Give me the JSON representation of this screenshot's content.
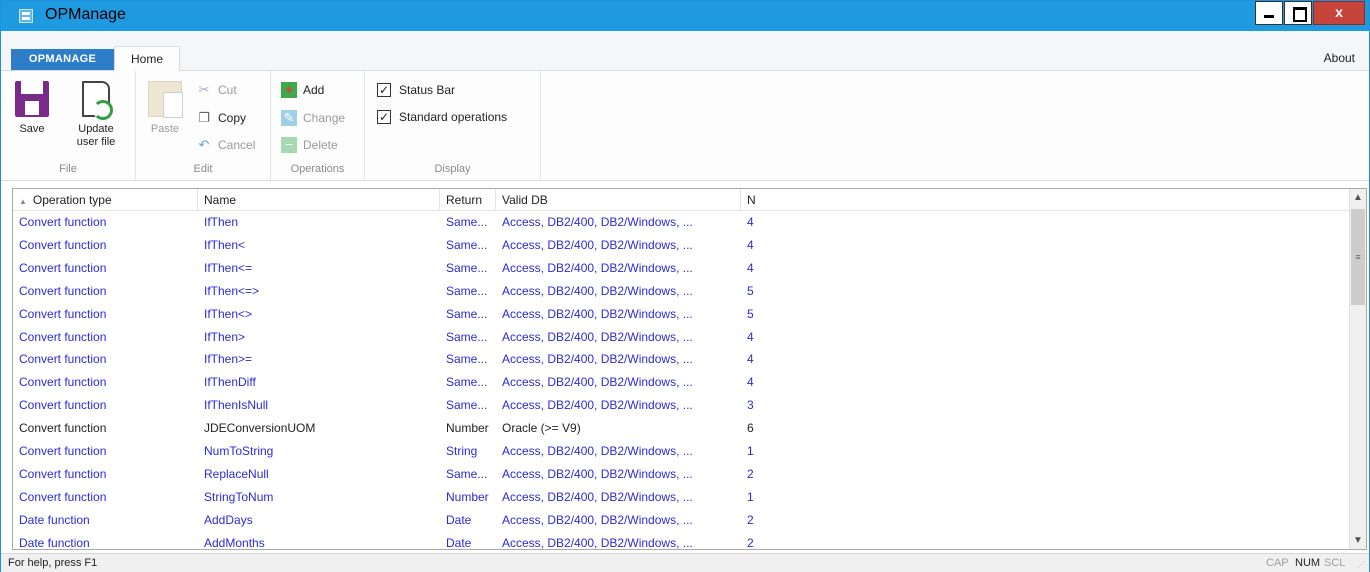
{
  "window": {
    "title": "OPManage"
  },
  "window_controls": {
    "close_label": "x"
  },
  "ribbon": {
    "app_tab": "OPMANAGE",
    "home_tab": "Home",
    "about": "About",
    "file": {
      "label": "File",
      "save": "Save",
      "update_line1": "Update",
      "update_line2": "user file"
    },
    "edit": {
      "label": "Edit",
      "paste": "Paste",
      "cut": "Cut",
      "copy": "Copy",
      "cancel": "Cancel"
    },
    "operations": {
      "label": "Operations",
      "add": "Add",
      "change": "Change",
      "delete": "Delete"
    },
    "display": {
      "label": "Display",
      "status_bar": "Status Bar",
      "status_bar_checked": true,
      "standard_operations": "Standard operations",
      "standard_operations_checked": true
    }
  },
  "table": {
    "columns": [
      "Operation type",
      "Name",
      "Return",
      "Valid DB",
      "N"
    ],
    "rows": [
      {
        "type": "Convert function",
        "name": "IfThen",
        "ret": "Same...",
        "db": "Access, DB2/400, DB2/Windows, ...",
        "n": "4",
        "color": "blue"
      },
      {
        "type": "Convert function",
        "name": "IfThen<",
        "ret": "Same...",
        "db": "Access, DB2/400, DB2/Windows, ...",
        "n": "4",
        "color": "blue"
      },
      {
        "type": "Convert function",
        "name": "IfThen<=",
        "ret": "Same...",
        "db": "Access, DB2/400, DB2/Windows, ...",
        "n": "4",
        "color": "blue"
      },
      {
        "type": "Convert function",
        "name": "IfThen<=>",
        "ret": "Same...",
        "db": "Access, DB2/400, DB2/Windows, ...",
        "n": "5",
        "color": "blue"
      },
      {
        "type": "Convert function",
        "name": "IfThen<>",
        "ret": "Same...",
        "db": "Access, DB2/400, DB2/Windows, ...",
        "n": "5",
        "color": "blue"
      },
      {
        "type": "Convert function",
        "name": "IfThen>",
        "ret": "Same...",
        "db": "Access, DB2/400, DB2/Windows, ...",
        "n": "4",
        "color": "blue"
      },
      {
        "type": "Convert function",
        "name": "IfThen>=",
        "ret": "Same...",
        "db": "Access, DB2/400, DB2/Windows, ...",
        "n": "4",
        "color": "blue"
      },
      {
        "type": "Convert function",
        "name": "IfThenDiff",
        "ret": "Same...",
        "db": "Access, DB2/400, DB2/Windows, ...",
        "n": "4",
        "color": "blue"
      },
      {
        "type": "Convert function",
        "name": "IfThenIsNull",
        "ret": "Same...",
        "db": "Access, DB2/400, DB2/Windows, ...",
        "n": "3",
        "color": "blue"
      },
      {
        "type": "Convert function",
        "name": "JDEConversionUOM",
        "ret": "Number",
        "db": "Oracle (>= V9)",
        "n": "6",
        "color": "black"
      },
      {
        "type": "Convert function",
        "name": "NumToString",
        "ret": "String",
        "db": "Access, DB2/400, DB2/Windows, ...",
        "n": "1",
        "color": "blue"
      },
      {
        "type": "Convert function",
        "name": "ReplaceNull",
        "ret": "Same...",
        "db": "Access, DB2/400, DB2/Windows, ...",
        "n": "2",
        "color": "blue"
      },
      {
        "type": "Convert function",
        "name": "StringToNum",
        "ret": "Number",
        "db": "Access, DB2/400, DB2/Windows, ...",
        "n": "1",
        "color": "blue"
      },
      {
        "type": "Date function",
        "name": "AddDays",
        "ret": "Date",
        "db": "Access, DB2/400, DB2/Windows, ...",
        "n": "2",
        "color": "blue"
      },
      {
        "type": "Date function",
        "name": "AddMonths",
        "ret": "Date",
        "db": "Access, DB2/400, DB2/Windows, ...",
        "n": "2",
        "color": "blue"
      }
    ]
  },
  "statusbar": {
    "help": "For help, press F1",
    "cap": "CAP",
    "num": "NUM",
    "scl": "SCL"
  },
  "colors": {
    "titlebar": "#1e9ae0",
    "link_blue": "#2b2bd6",
    "app_tab": "#2d7dc8"
  }
}
